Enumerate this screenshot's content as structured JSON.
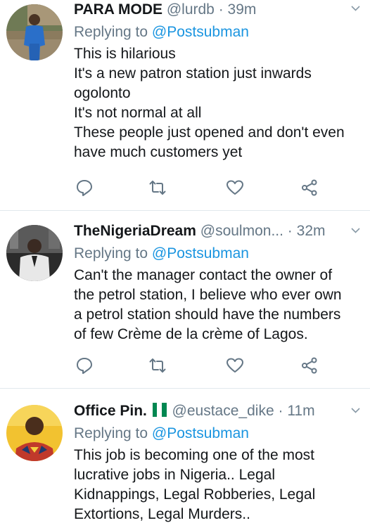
{
  "tweets": [
    {
      "name": "PARA MODE",
      "handle": "@lurdb",
      "sep": "·",
      "time": "39m",
      "replying_prefix": "Replying to ",
      "replying_to": "@Postsubman",
      "lines": [
        "This is hilarious",
        "It's a new patron station just inwards",
        "ogolonto",
        "It's not normal at all",
        "These people just opened and don't even",
        "have much customers yet"
      ]
    },
    {
      "name": "TheNigeriaDream",
      "handle": "@soulmon...",
      "sep": "·",
      "time": "32m",
      "replying_prefix": "Replying to ",
      "replying_to": "@Postsubman",
      "lines": [
        "Can't the manager contact the owner of",
        "the petrol station, I believe who ever own",
        "a petrol station should have the numbers",
        "of few Crème de la crème of Lagos."
      ]
    },
    {
      "name": "Office Pin.",
      "handle": "@eustace_dike",
      "sep": "·",
      "time": "11m",
      "replying_prefix": "Replying to ",
      "replying_to": "@Postsubman",
      "lines": [
        "This job is becoming one of the most",
        "lucrative jobs in Nigeria.. Legal",
        "Kidnappings, Legal Robberies, Legal",
        "Extortions, Legal Murders.."
      ]
    }
  ],
  "icons": {
    "reply": "reply-icon",
    "retweet": "retweet-icon",
    "like": "heart-icon",
    "share": "share-icon",
    "menu": "chevron-down-icon",
    "flag": "nigeria-flag-icon"
  },
  "colors": {
    "text": "#14171a",
    "secondary": "#657786",
    "link": "#1b95e0",
    "flag_green": "#008751",
    "flag_white": "#ffffff"
  }
}
